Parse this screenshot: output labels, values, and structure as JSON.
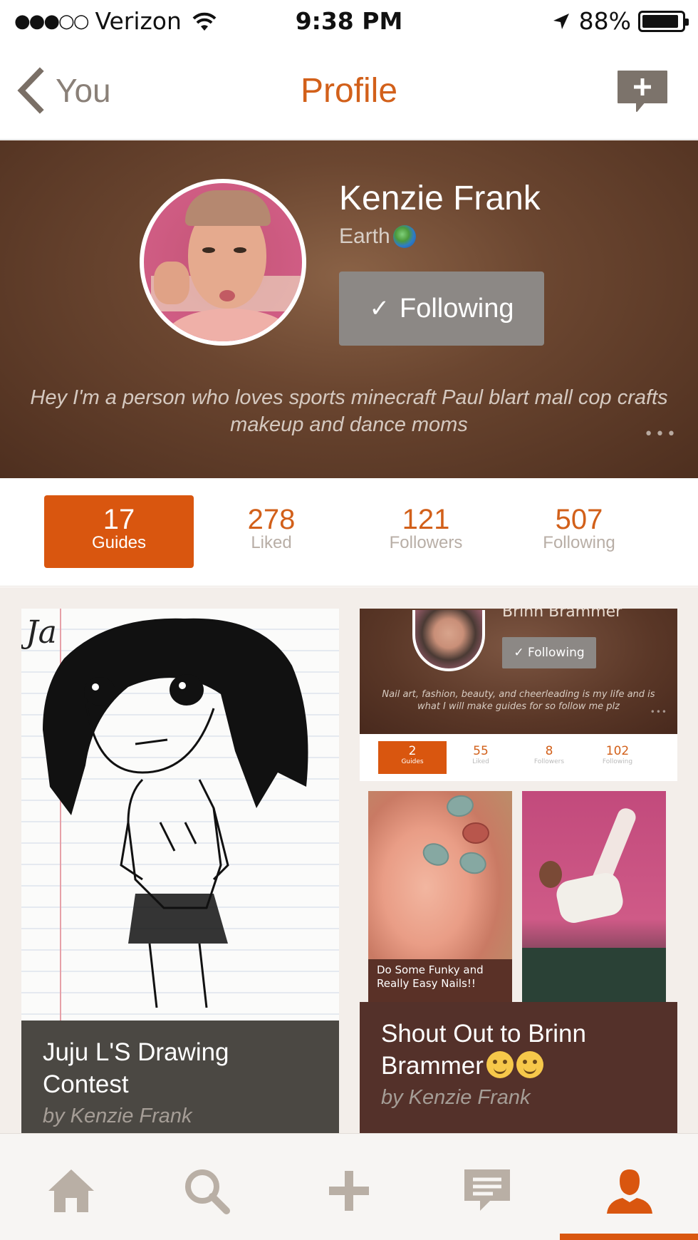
{
  "status_bar": {
    "carrier": "Verizon",
    "signal_dots": "●●●○○",
    "time": "9:38 PM",
    "battery_percent": "88%"
  },
  "nav": {
    "back_label": "You",
    "title": "Profile",
    "compose_icon": "compose-plus-icon"
  },
  "profile": {
    "name": "Kenzie Frank",
    "location": "Earth",
    "follow_label": "Following",
    "bio": "Hey I'm a person who loves sports minecraft Paul blart mall cop crafts makeup and dance moms",
    "more": "•••"
  },
  "stats": [
    {
      "value": "17",
      "label": "Guides",
      "active": true
    },
    {
      "value": "278",
      "label": "Liked",
      "active": false
    },
    {
      "value": "121",
      "label": "Followers",
      "active": false
    },
    {
      "value": "507",
      "label": "Following",
      "active": false
    }
  ],
  "guides": [
    {
      "title": "Juju L'S Drawing Contest",
      "author": "by Kenzie Frank",
      "drawing_text": "Ja"
    },
    {
      "title": "Shout Out to Brinn Brammer",
      "author": "by Kenzie Frank",
      "preview": {
        "name": "Brinn Brammer",
        "follow_label": "Following",
        "bio": "Nail art, fashion, beauty, and cheerleading is my life and is what I will make guides for so follow me plz",
        "more": "•••",
        "stats": [
          {
            "value": "2",
            "label": "Guides"
          },
          {
            "value": "55",
            "label": "Liked"
          },
          {
            "value": "8",
            "label": "Followers"
          },
          {
            "value": "102",
            "label": "Following"
          }
        ],
        "tile_caption": "Do Some Funky and Really Easy Nails!!"
      }
    }
  ],
  "tab_bar": {
    "tabs": [
      "home-icon",
      "search-icon",
      "add-icon",
      "messages-icon",
      "profile-icon"
    ],
    "active": "profile-icon"
  },
  "colors": {
    "accent": "#d9560f",
    "header_brown": "#6b4630",
    "tab_inactive": "#b9afa5"
  }
}
